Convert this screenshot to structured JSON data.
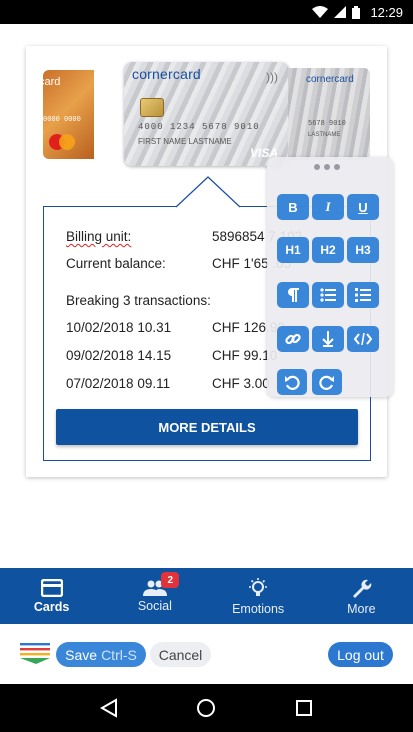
{
  "status_bar": {
    "time": "12:29",
    "icons": [
      "wifi-icon",
      "signal-icon",
      "battery-icon"
    ]
  },
  "cards": {
    "left": {
      "brand_fragment": "card",
      "number_fragment": "0000 0000"
    },
    "main": {
      "brand": "cornercard",
      "number": "4000 1234 5678 9010",
      "holder": "FIRST NAME  LASTNAME",
      "network": "VISA"
    },
    "right": {
      "brand_fragment": "cornercard",
      "number_fragment": "5678 9010",
      "holder_fragment": "LASTNAME"
    }
  },
  "details": {
    "billing_unit_label": "Billing unit:",
    "billing_unit_value": "5896854 7 102",
    "current_balance_label": "Current balance:",
    "current_balance_value": "CHF 1'65 .05",
    "transactions_heading": "Breaking 3 transactions:",
    "transactions": [
      {
        "date": "10/02/2018 10.31",
        "amount": "CHF 126.90"
      },
      {
        "date": "09/02/2018 14.15",
        "amount": "CHF 99.10"
      },
      {
        "date": "07/02/2018 09.11",
        "amount": "CHF 3.00"
      }
    ],
    "more_details_label": "MORE DETAILS"
  },
  "toolbar": {
    "bold": "B",
    "italic": "I",
    "underline": "U",
    "h1": "H1",
    "h2": "H2",
    "h3": "H3"
  },
  "tabs": [
    {
      "label": "Cards",
      "icon": "card-icon",
      "active": true
    },
    {
      "label": "Social",
      "icon": "people-icon",
      "badge": "2"
    },
    {
      "label": "Emotions",
      "icon": "lightbulb-icon"
    },
    {
      "label": "More",
      "icon": "wrench-icon"
    }
  ],
  "actions": {
    "save_label": "Save",
    "save_shortcut": "Ctrl-S",
    "cancel_label": "Cancel",
    "logout_label": "Log out"
  },
  "colors": {
    "brand_blue": "#0f52a0",
    "button_blue": "#3a86d8",
    "badge_red": "#e0333a"
  }
}
